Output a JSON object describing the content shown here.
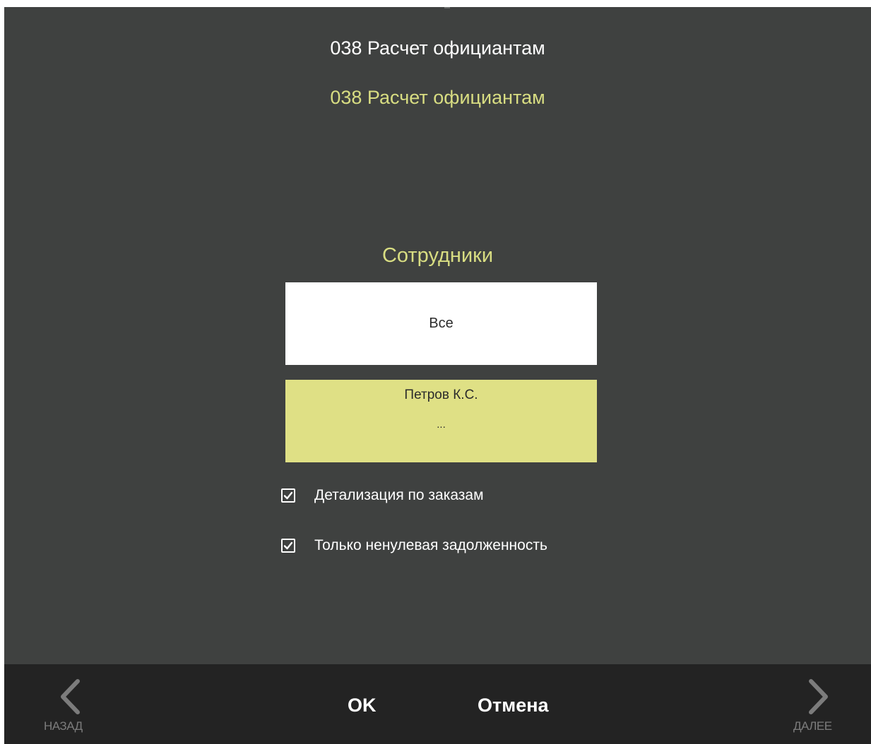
{
  "dialog": {
    "title": "038 Расчет официантам",
    "subtitle": "038 Расчет официантам"
  },
  "employees": {
    "label": "Сотрудники",
    "option_all": "Все",
    "selected_name": "Петров К.С.",
    "selected_more": "..."
  },
  "options": [
    {
      "label": "Детализация по заказам",
      "checked": true
    },
    {
      "label": "Только ненулевая задолженность",
      "checked": true
    }
  ],
  "footer": {
    "back_label": "НАЗАД",
    "next_label": "ДАЛЕЕ",
    "ok_label": "OK",
    "cancel_label": "Отмена"
  },
  "colors": {
    "background": "#3f4140",
    "accent": "#d8dd82",
    "selected_fill": "#dfe085",
    "footer": "#232323"
  },
  "icons": {
    "back": "chevron-left-icon",
    "next": "chevron-right-icon",
    "checkbox": "checkmark-icon"
  }
}
